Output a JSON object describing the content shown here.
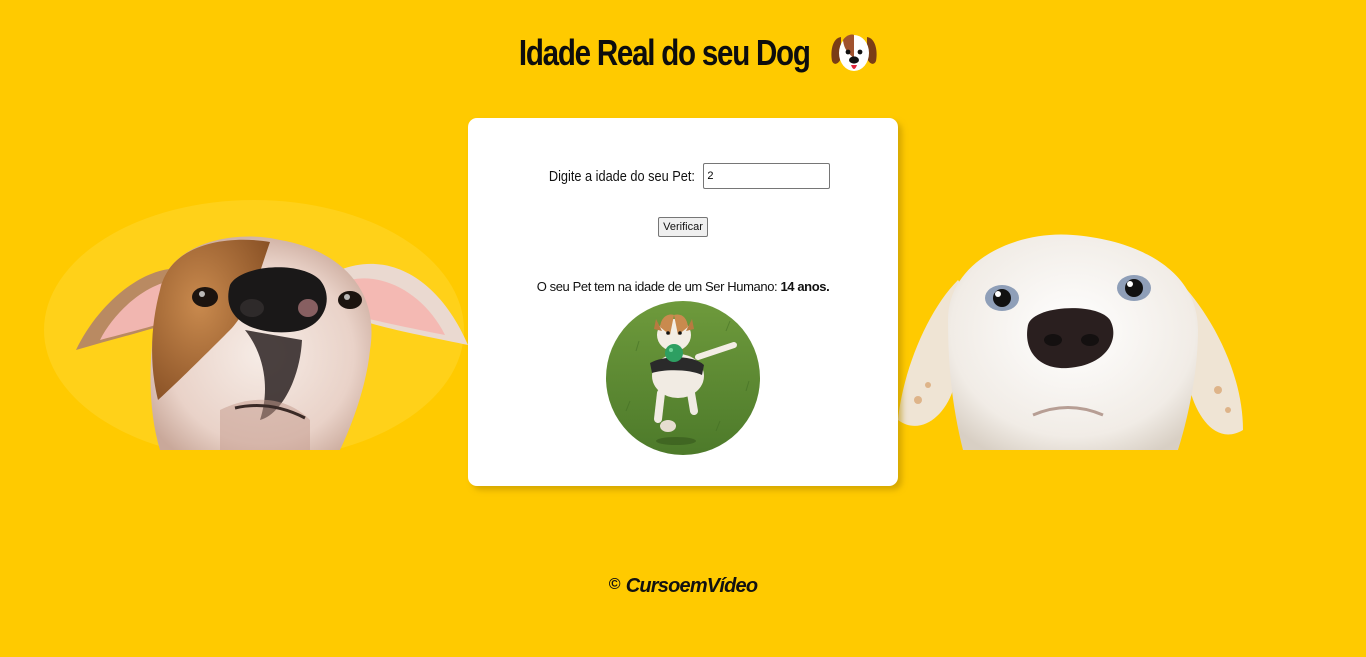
{
  "header": {
    "title": "Idade Real do seu Dog",
    "icon": "dog-face-icon"
  },
  "form": {
    "label": "Digite a idade do seu Pet:",
    "input_value": "2",
    "button_label": "Verificar"
  },
  "result": {
    "prefix": "O seu Pet tem na idade de um Ser Humano:",
    "value": "14 anos."
  },
  "footer": {
    "copyright_symbol": "©",
    "text": "CursoemVídeo"
  },
  "colors": {
    "background": "#FFCA00",
    "card": "#FFFFFF"
  }
}
